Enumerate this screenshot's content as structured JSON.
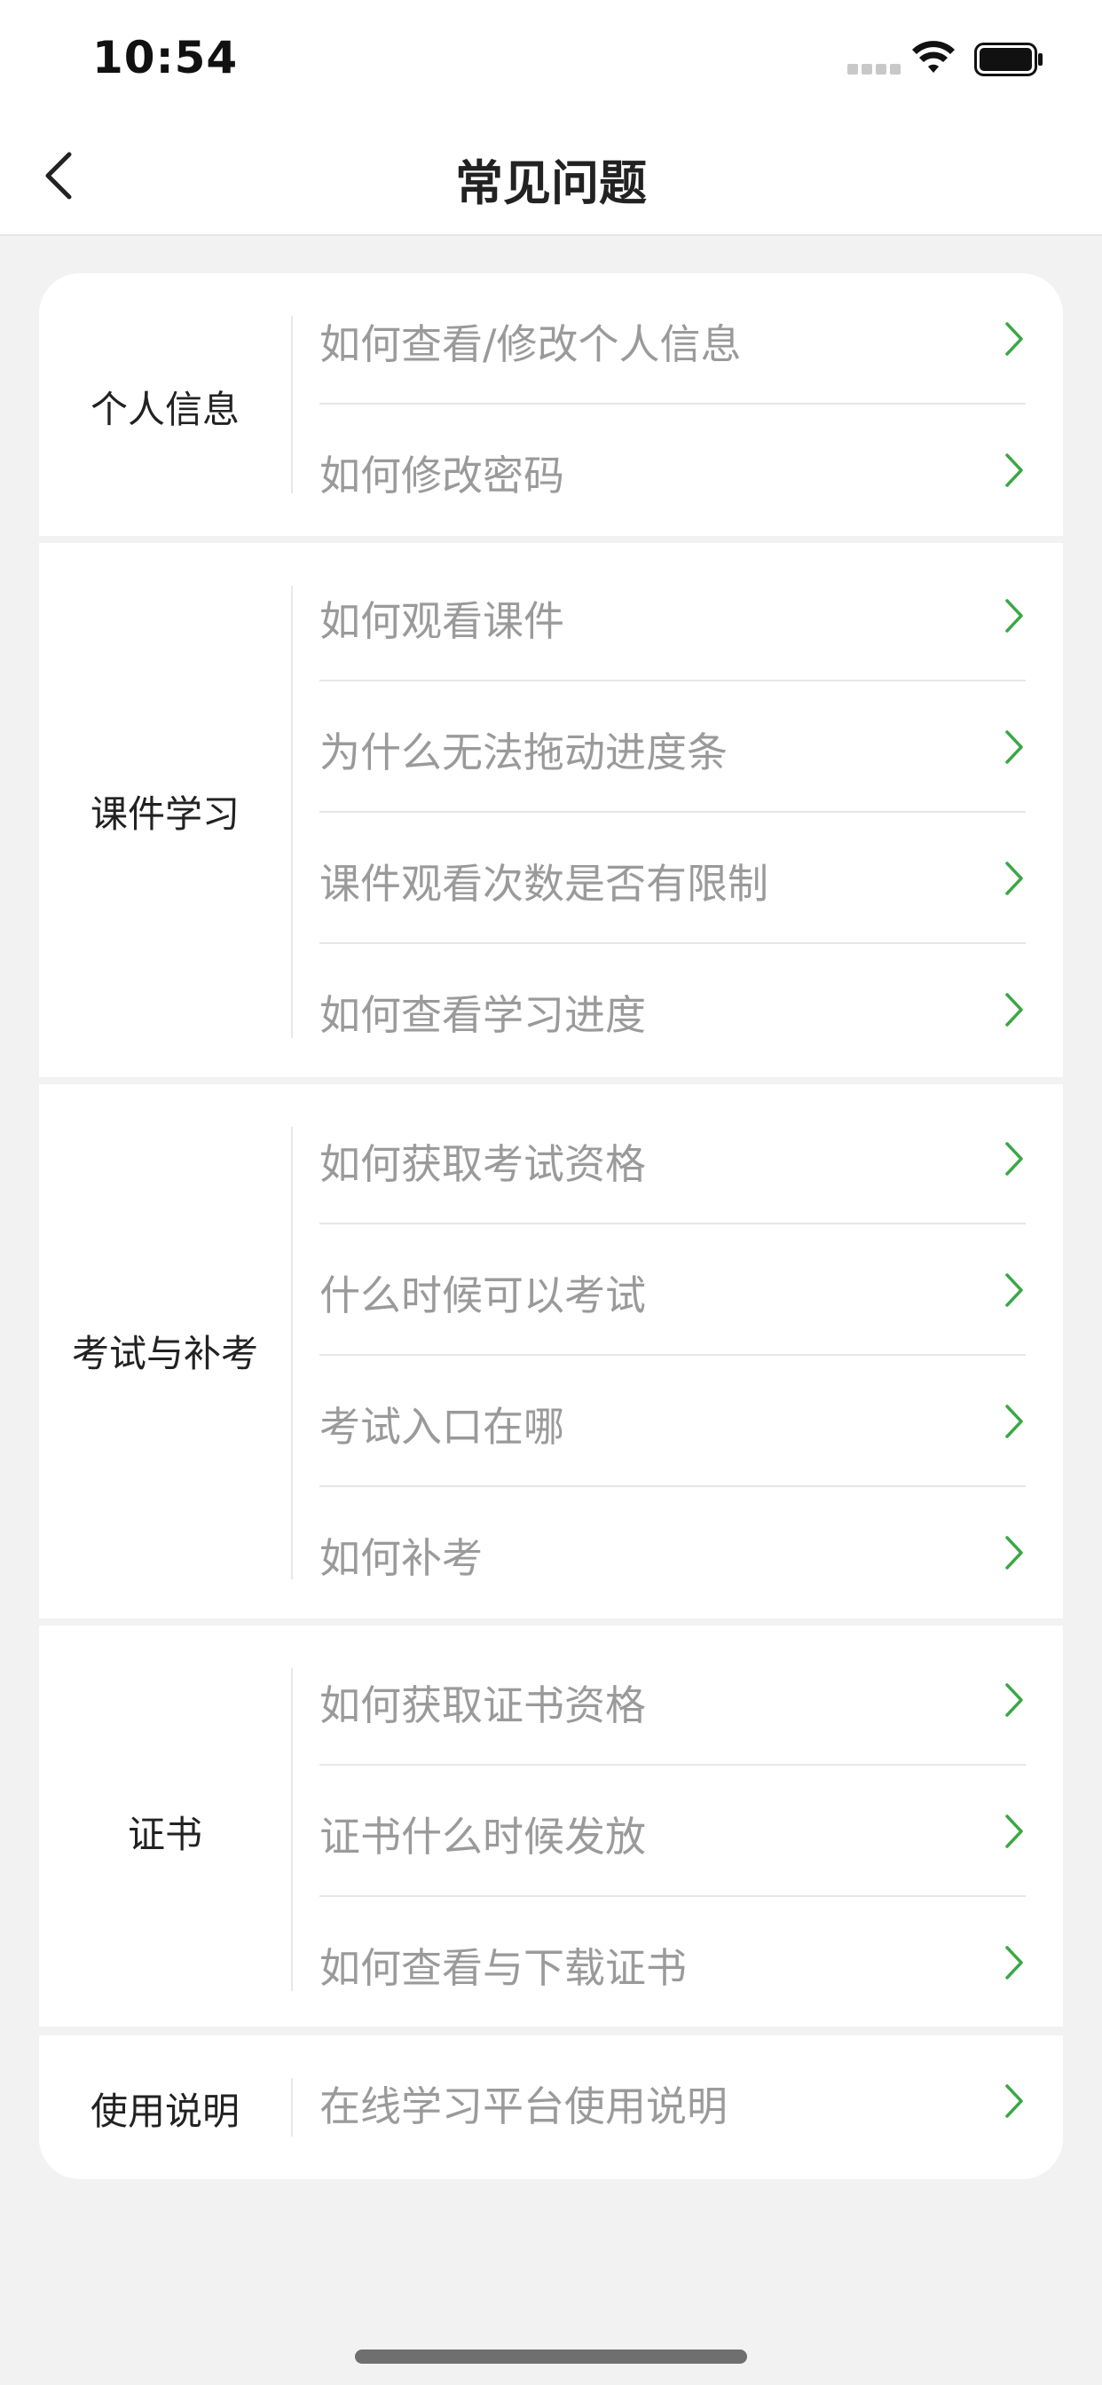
{
  "status_bar": {
    "time": "10:54",
    "icons": [
      "signal-icon",
      "wifi-icon",
      "battery-icon"
    ]
  },
  "nav": {
    "back_icon": "chevron-left-icon",
    "title": "常见问题"
  },
  "colors": {
    "accent": "#3aa845",
    "label_text": "#222222",
    "item_text": "#9a9a9a",
    "background": "#f2f2f2",
    "card": "#ffffff"
  },
  "sections": [
    {
      "label": "个人信息",
      "items": [
        {
          "label": "如何查看/修改个人信息"
        },
        {
          "label": "如何修改密码"
        }
      ]
    },
    {
      "label": "课件学习",
      "items": [
        {
          "label": "如何观看课件"
        },
        {
          "label": "为什么无法拖动进度条"
        },
        {
          "label": "课件观看次数是否有限制"
        },
        {
          "label": "如何查看学习进度"
        }
      ]
    },
    {
      "label": "考试与补考",
      "items": [
        {
          "label": "如何获取考试资格"
        },
        {
          "label": "什么时候可以考试"
        },
        {
          "label": "考试入口在哪"
        },
        {
          "label": "如何补考"
        }
      ]
    },
    {
      "label": "证书",
      "items": [
        {
          "label": "如何获取证书资格"
        },
        {
          "label": "证书什么时候发放"
        },
        {
          "label": "如何查看与下载证书"
        }
      ]
    },
    {
      "label": "使用说明",
      "items": [
        {
          "label": "在线学习平台使用说明"
        }
      ]
    }
  ]
}
